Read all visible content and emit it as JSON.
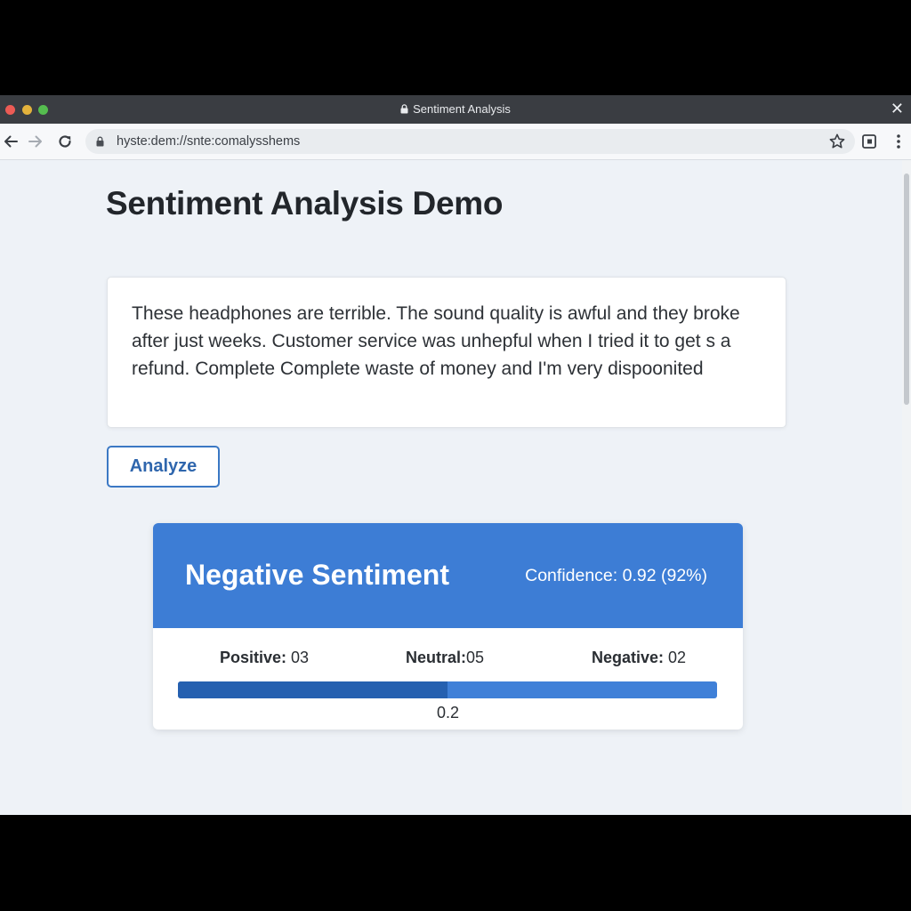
{
  "window": {
    "title": "Sentiment Analysis",
    "close_label": "✕"
  },
  "browser": {
    "url": "hyste:dem://snte:comalysshems"
  },
  "page": {
    "title": "Sentiment Analysis Demo",
    "review_text": "These headphones are terrible. The sound quality is awful and they broke after just  weeks. Customer service was unhepful when I tried it to get s a refund. Complete Complete waste of money and I'm very dispoonited",
    "analyze_label": "Analyze"
  },
  "result": {
    "label": "Negative Sentiment",
    "confidence": "Confidence: 0.92 (92%)",
    "scores": {
      "positive_label": "Positive:",
      "positive_value": "03",
      "neutral_label": "Neutral:",
      "neutral_value": "05",
      "negative_label": "Negative:",
      "negative_value": "02"
    },
    "bar_value": "0.2",
    "bar_fill_fraction": 0.5
  },
  "colors": {
    "accent": "#3d7dd5",
    "accent_dark": "#2560b0",
    "button_border": "#3b78c4"
  },
  "icons": {
    "back": "arrow-left-icon",
    "forward": "arrow-right-icon",
    "reload": "reload-icon",
    "lock": "lock-icon",
    "star": "star-icon",
    "extension": "extension-icon",
    "menu": "kebab-menu-icon"
  }
}
